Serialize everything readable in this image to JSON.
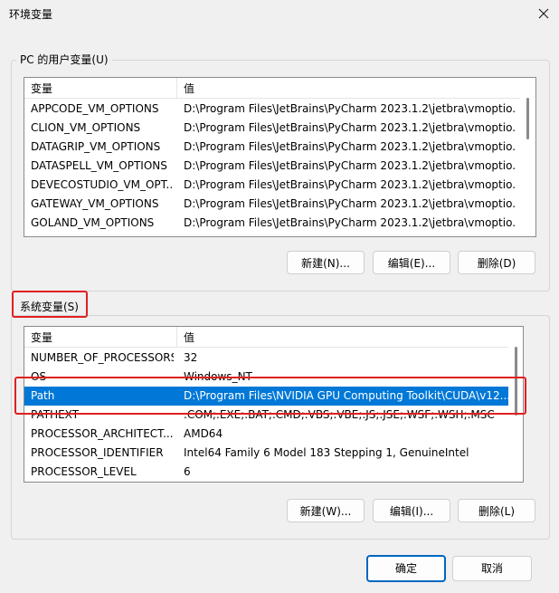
{
  "window": {
    "title": "环境变量"
  },
  "user_vars": {
    "legend": "PC 的用户变量(U)",
    "col_name": "变量",
    "col_value": "值",
    "rows": [
      {
        "name": "APPCODE_VM_OPTIONS",
        "value": "D:\\Program Files\\JetBrains\\PyCharm 2023.1.2\\jetbra\\vmoptio..."
      },
      {
        "name": "CLION_VM_OPTIONS",
        "value": "D:\\Program Files\\JetBrains\\PyCharm 2023.1.2\\jetbra\\vmoptio..."
      },
      {
        "name": "DATAGRIP_VM_OPTIONS",
        "value": "D:\\Program Files\\JetBrains\\PyCharm 2023.1.2\\jetbra\\vmoptio..."
      },
      {
        "name": "DATASPELL_VM_OPTIONS",
        "value": "D:\\Program Files\\JetBrains\\PyCharm 2023.1.2\\jetbra\\vmoptio..."
      },
      {
        "name": "DEVECOSTUDIO_VM_OPT...",
        "value": "D:\\Program Files\\JetBrains\\PyCharm 2023.1.2\\jetbra\\vmoptio..."
      },
      {
        "name": "GATEWAY_VM_OPTIONS",
        "value": "D:\\Program Files\\JetBrains\\PyCharm 2023.1.2\\jetbra\\vmoptio..."
      },
      {
        "name": "GOLAND_VM_OPTIONS",
        "value": "D:\\Program Files\\JetBrains\\PyCharm 2023.1.2\\jetbra\\vmoptio..."
      }
    ],
    "buttons": {
      "new": "新建(N)...",
      "edit": "编辑(E)...",
      "delete": "删除(D)"
    }
  },
  "system_vars": {
    "legend": "系统变量(S)",
    "col_name": "变量",
    "col_value": "值",
    "rows": [
      {
        "name": "NUMBER_OF_PROCESSORS",
        "value": "32"
      },
      {
        "name": "OS",
        "value": "Windows_NT"
      },
      {
        "name": "Path",
        "value": "D:\\Program Files\\NVIDIA GPU Computing Toolkit\\CUDA\\v12...."
      },
      {
        "name": "PATHEXT",
        "value": ".COM;.EXE;.BAT;.CMD;.VBS;.VBE;.JS;.JSE;.WSF;.WSH;.MSC"
      },
      {
        "name": "PROCESSOR_ARCHITECT...",
        "value": "AMD64"
      },
      {
        "name": "PROCESSOR_IDENTIFIER",
        "value": "Intel64 Family 6 Model 183 Stepping 1, GenuineIntel"
      },
      {
        "name": "PROCESSOR_LEVEL",
        "value": "6"
      }
    ],
    "selected_row": "Path",
    "buttons": {
      "new": "新建(W)...",
      "edit": "编辑(I)...",
      "delete": "删除(L)"
    }
  },
  "footer": {
    "ok": "确定",
    "cancel": "取消"
  },
  "colors": {
    "selection": "#0078d7",
    "highlight_box": "#e02020",
    "default_button_border": "#0067c0"
  }
}
